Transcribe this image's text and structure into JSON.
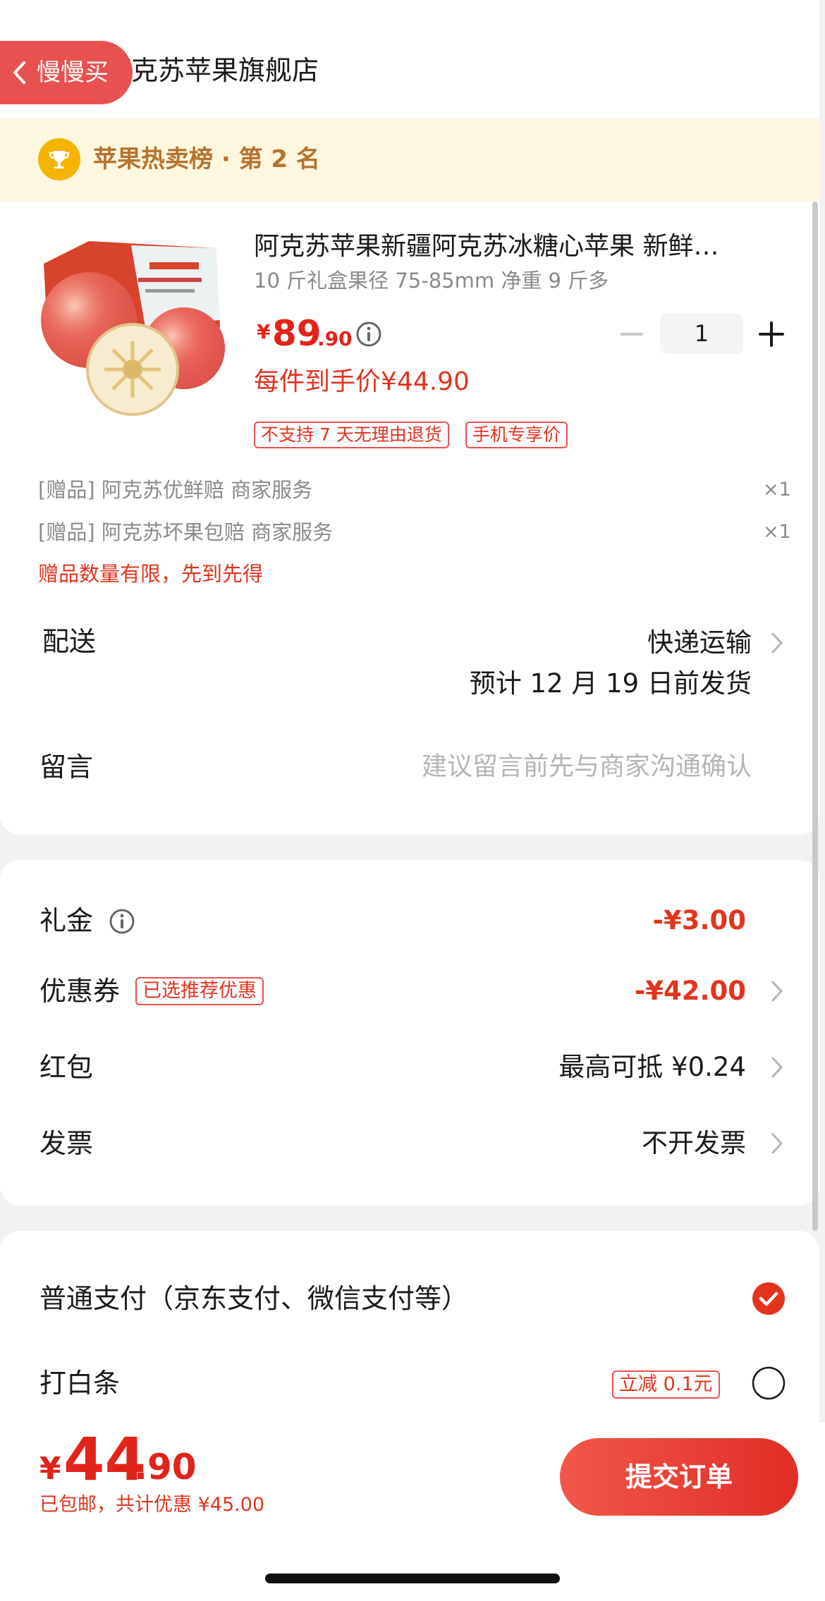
{
  "header": {
    "back_label": "慢慢买",
    "store_name": "阿克苏苹果旗舰店"
  },
  "rank": {
    "text": "苹果热卖榜 · 第 2 名",
    "accent": "#f5b400"
  },
  "product": {
    "title": "阿克苏苹果新疆阿克苏冰糖心苹果 新鲜…",
    "spec": "10 斤礼盒果径 75-85mm 净重 9 斤多",
    "price_symbol": "¥",
    "price_int": "89",
    "price_dec": ".90",
    "quantity": "1",
    "hand_price": "每件到手价¥44.90",
    "tags": [
      "不支持 7 天无理由退货",
      "手机专享价"
    ]
  },
  "gifts": {
    "items": [
      {
        "label": "[赠品] 阿克苏优鲜赔 商家服务",
        "qty": "×1"
      },
      {
        "label": "[赠品] 阿克苏坏果包赔 商家服务",
        "qty": "×1"
      }
    ],
    "limit_note": "赠品数量有限，先到先得"
  },
  "delivery": {
    "label": "配送",
    "method": "快递运输",
    "eta": "预计 12 月 19 日前发货"
  },
  "message": {
    "label": "留言",
    "placeholder": "建议留言前先与商家沟通确认"
  },
  "discounts": {
    "gift_money_label": "礼金",
    "gift_money_value": "-¥3.00",
    "coupon_label": "优惠券",
    "coupon_tag": "已选推荐优惠",
    "coupon_value": "-¥42.00",
    "red_packet_label": "红包",
    "red_packet_value": "最高可抵 ¥0.24",
    "invoice_label": "发票",
    "invoice_value": "不开发票"
  },
  "payment": {
    "normal_label": "普通支付（京东支付、微信支付等）",
    "normal_selected": true,
    "baitiao_label": "打白条",
    "baitiao_tag": "立减 0.1元",
    "baitiao_selected": false
  },
  "bottom": {
    "total_symbol": "¥",
    "total_int": "44",
    "total_dec": ".90",
    "summary": "已包邮，共计优惠 ¥45.00",
    "submit_label": "提交订单"
  },
  "colors": {
    "brand_red": "#e2341d",
    "button_red": "#e8514f"
  }
}
